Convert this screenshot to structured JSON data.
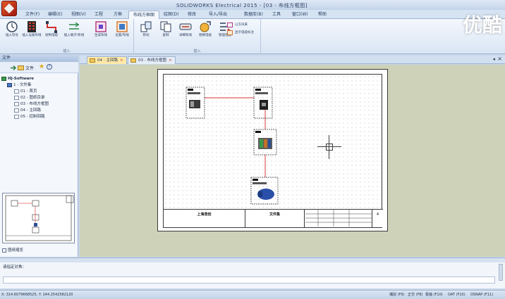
{
  "window": {
    "title": "SOLIDWORKS Electrical 2015 - [03 - 布线方框图]",
    "brand_watermark": "优酷"
  },
  "menu": {
    "tabs": [
      {
        "label": "文件(F)"
      },
      {
        "label": "编辑(E)"
      },
      {
        "label": "视图(V)"
      },
      {
        "label": "工程"
      },
      {
        "label": "方框"
      },
      {
        "label": "布线方框图"
      },
      {
        "label": "绘图(D)"
      },
      {
        "label": "修改"
      },
      {
        "label": "导入/导出"
      },
      {
        "label": "数据库(B)"
      },
      {
        "label": "工具"
      },
      {
        "label": "窗口(W)"
      },
      {
        "label": "帮助"
      }
    ],
    "active_index": 5
  },
  "ribbon": {
    "group1_label": "插入",
    "group2_label": "插入",
    "buttons": [
      {
        "label": "插入符号",
        "icon": "clock-symbol-icon"
      },
      {
        "label": "插入设备布线",
        "icon": "device-grid-icon"
      },
      {
        "label": "绘制电缆",
        "icon": "draw-cable-icon"
      },
      {
        "label": "插入端子/布线",
        "icon": "terminal-icon"
      },
      {
        "label": "生成布线",
        "icon": "generate-wiring-icon"
      },
      {
        "label": "位置/布线",
        "icon": "location-icon"
      },
      {
        "label": "移动",
        "icon": "move-icon"
      },
      {
        "label": "复制",
        "icon": "copy-icon"
      },
      {
        "label": "详细布线",
        "icon": "detail-icon"
      },
      {
        "label": "替换电缆",
        "icon": "replace-icon"
      },
      {
        "label": "管理电缆",
        "icon": "manage-icon"
      }
    ],
    "small_buttons": [
      {
        "label": "以方块来",
        "icon": "block-icon"
      },
      {
        "label": "显示电缆标注",
        "icon": "show-label-icon"
      }
    ]
  },
  "left_panel": {
    "title": "文件",
    "toolbar_label": "文件",
    "tree": [
      {
        "label": "HJ-Software",
        "level": 0
      },
      {
        "label": "1 - 文件集",
        "level": 1
      },
      {
        "label": "01 - 首页",
        "level": 2
      },
      {
        "label": "02 - 图纸目录",
        "level": 2
      },
      {
        "label": "03 - 布线方框图",
        "level": 2
      },
      {
        "label": "04 - 主回路",
        "level": 2
      },
      {
        "label": "05 - 控制回路",
        "level": 2
      }
    ],
    "preview_checkbox_label": "图纸缩览"
  },
  "document_tabs": [
    {
      "label": "04 - 主回路",
      "active": true
    },
    {
      "label": "03 - 布线方框图",
      "active": false
    }
  ],
  "drawing": {
    "titleblock": {
      "company": "上海浩创",
      "doc_title": "文件集",
      "sheet_no": "4"
    }
  },
  "command": {
    "prompt": "请指定对角："
  },
  "status": {
    "coordinates": "X: 314.6079668525, Y: 144.2542582120",
    "modes": [
      {
        "label": "捕捉 (F9)"
      },
      {
        "label": "正交 (F8)"
      },
      {
        "label": "极轴 (F10)"
      },
      {
        "label": "OAT (F10)"
      },
      {
        "label": "OSNAP (F11)"
      }
    ]
  },
  "colors": {
    "ribbon_bg": "#d9e5f4",
    "active_doc_tab": "#ffe9a8",
    "workspace_bg": "#cdd2b8",
    "link_line": "#e05a5a"
  }
}
